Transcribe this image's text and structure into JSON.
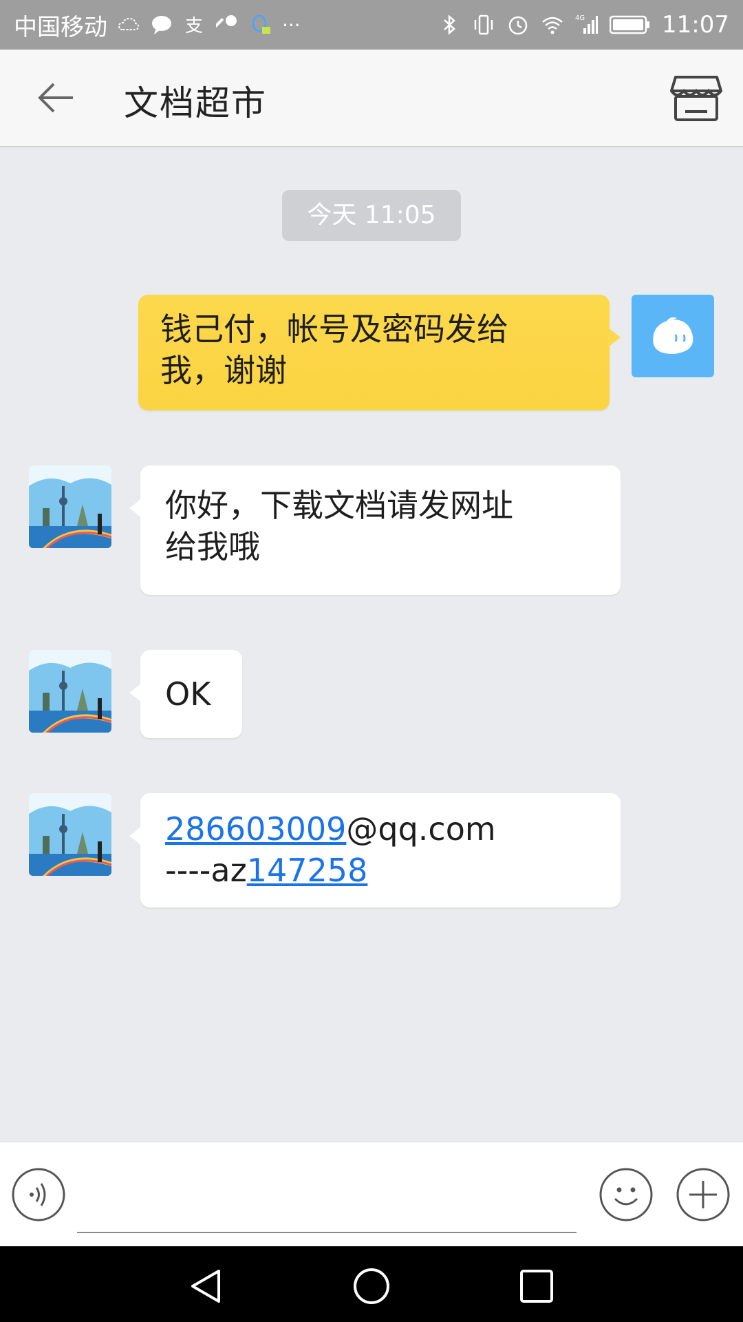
{
  "status_bar": {
    "carrier": "中国移动",
    "network": "4G",
    "time": "11:07",
    "icons_left": [
      "cloud-icon",
      "chat-icon",
      "alipay-icon",
      "key-icon",
      "qq-icon",
      "more-dots-icon"
    ],
    "icons_right": [
      "bluetooth-icon",
      "vibrate-icon",
      "alarm-icon",
      "wifi-icon",
      "signal-icon",
      "battery-icon"
    ],
    "more": "···"
  },
  "header": {
    "title": "文档超市",
    "back_icon": "back-arrow-icon",
    "shop_icon": "store-icon"
  },
  "chat": {
    "timestamp": "今天 11:05",
    "messages": [
      {
        "sender": "me",
        "text_line1": "钱己付，帐号及密码发给",
        "text_line2": "我，谢谢"
      },
      {
        "sender": "other",
        "text_line1": "你好，下载文档请发网址",
        "text_line2": "给我哦"
      },
      {
        "sender": "other",
        "text": "OK"
      },
      {
        "sender": "other",
        "link1": "286603009",
        "text_after_link1": "@qq.com",
        "text_before_link2": "----az",
        "link2": "147258"
      }
    ]
  },
  "input_bar": {
    "placeholder": "",
    "voice_icon": "voice-icon",
    "emoji_icon": "emoji-icon",
    "plus_icon": "plus-icon"
  },
  "colors": {
    "my_bubble": "#fcd84c",
    "other_bubble": "#ffffff",
    "link": "#1a73e8",
    "background": "#e9ebee",
    "my_avatar": "#5bb6f7"
  }
}
